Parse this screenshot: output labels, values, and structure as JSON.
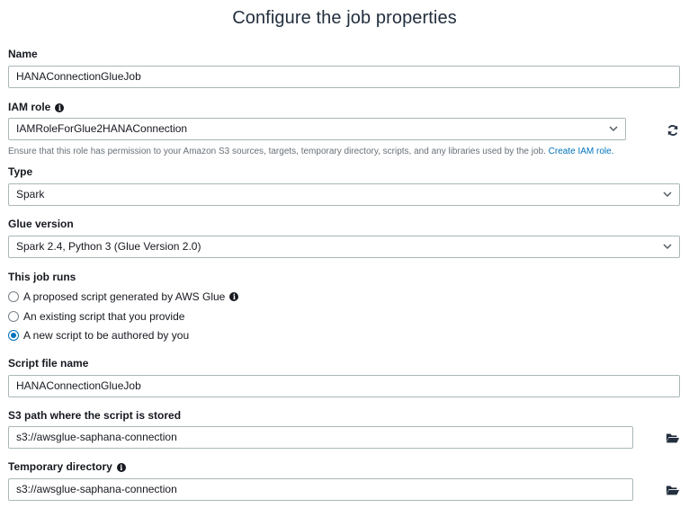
{
  "page": {
    "title": "Configure the job properties"
  },
  "name": {
    "label": "Name",
    "value": "HANAConnectionGlueJob"
  },
  "iam_role": {
    "label": "IAM role",
    "value": "IAMRoleForGlue2HANAConnection",
    "helper_text": "Ensure that this role has permission to your Amazon S3 sources, targets, temporary directory, scripts, and any libraries used by the job.",
    "create_link": "Create IAM role."
  },
  "type": {
    "label": "Type",
    "value": "Spark"
  },
  "glue_version": {
    "label": "Glue version",
    "value": "Spark 2.4, Python 3 (Glue Version 2.0)"
  },
  "job_runs": {
    "label": "This job runs",
    "options": [
      {
        "label": "A proposed script generated by AWS Glue",
        "selected": false
      },
      {
        "label": "An existing script that you provide",
        "selected": false
      },
      {
        "label": "A new script to be authored by you",
        "selected": true
      }
    ]
  },
  "script_file_name": {
    "label": "Script file name",
    "value": "HANAConnectionGlueJob"
  },
  "s3_path": {
    "label": "S3 path where the script is stored",
    "value": "s3://awsglue-saphana-connection"
  },
  "temp_dir": {
    "label": "Temporary directory",
    "value": "s3://awsglue-saphana-connection"
  },
  "icons": {
    "info": "info-icon",
    "refresh": "refresh-icon",
    "folder": "folder-open-icon",
    "chevron": "chevron-down-icon"
  },
  "colors": {
    "link": "#0073bb",
    "radio_selected": "#0073bb",
    "field_border": "#aab7b8"
  }
}
